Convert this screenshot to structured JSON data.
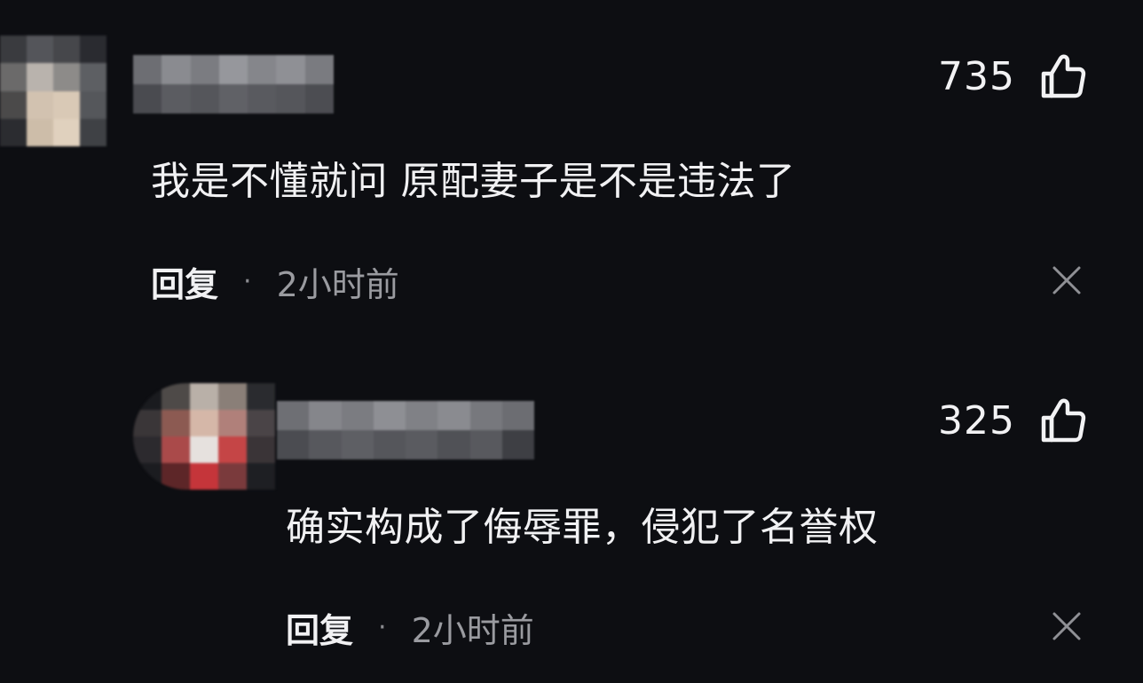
{
  "comments": [
    {
      "like_count": "735",
      "text": "我是不懂就问 原配妻子是不是违法了",
      "reply_label": "回复",
      "separator": "·",
      "time": "2小时前"
    },
    {
      "like_count": "325",
      "text": "确实构成了侮辱罪，侵犯了名誉权",
      "reply_label": "回复",
      "separator": "·",
      "time": "2小时前"
    }
  ],
  "colors": {
    "background": "#0d0e12",
    "text": "#f1f1f3",
    "muted": "#9a9ba0"
  },
  "icons": {
    "like": "thumbs-up-icon",
    "dismiss": "close-icon"
  }
}
